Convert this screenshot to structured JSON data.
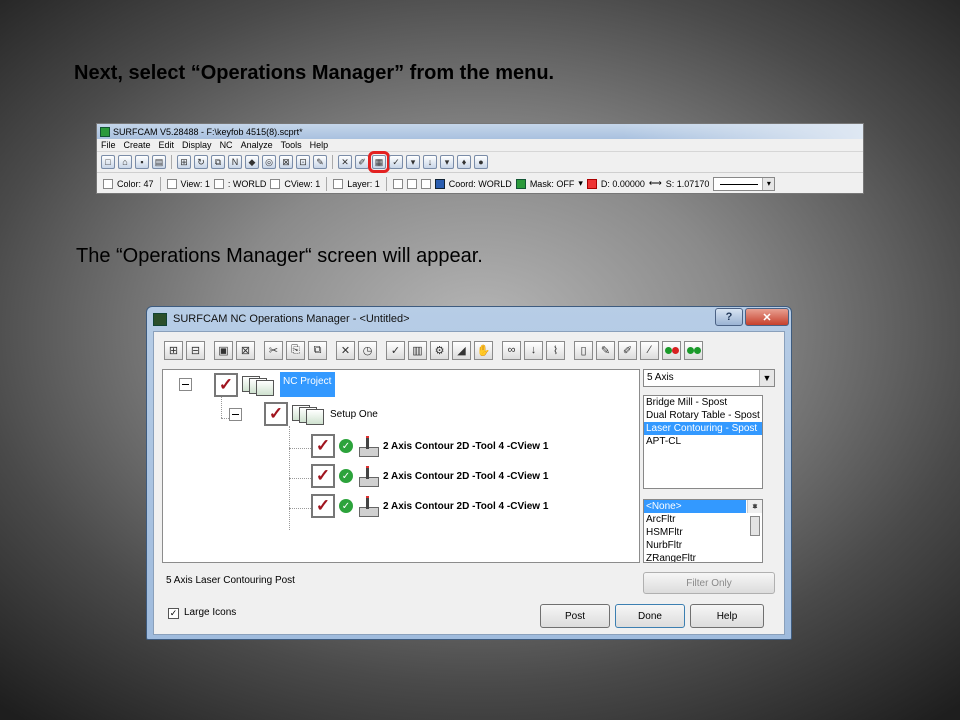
{
  "captions": {
    "step1": "Next, select  “Operations Manager” from the menu.",
    "step2": "The “Operations Manager“ screen will appear."
  },
  "surfcam": {
    "title": "SURFCAM V5.28488 - F:\\keyfob 4515(8).scprt*",
    "menu": [
      "File",
      "Create",
      "Edit",
      "Display",
      "NC",
      "Analyze",
      "Tools",
      "Help"
    ],
    "status": {
      "color": "Color: 47",
      "view": "View: 1",
      "world": ": WORLD",
      "cview": "CView: 1",
      "layer": "Layer: 1",
      "coord": "Coord: WORLD",
      "mask": "Mask: OFF",
      "d": "D: 0.00000",
      "s": "S: 1.07170"
    }
  },
  "ops_manager": {
    "title": "SURFCAM NC Operations Manager - <Untitled>",
    "tree": {
      "project": "NC Project",
      "setup": "Setup One",
      "operations": [
        "2 Axis Contour 2D  -Tool 4 -CView 1",
        "2 Axis Contour 2D  -Tool 4 -CView 1",
        "2 Axis Contour 2D  -Tool 4 -CView 1"
      ]
    },
    "axis_combo": "5 Axis",
    "posts": [
      "Bridge Mill - Spost",
      "Dual Rotary Table - Spost",
      "Laser Contouring - Spost",
      "APT-CL"
    ],
    "selected_post_index": 2,
    "filters": [
      "<None>",
      "ArcFltr",
      "HSMFltr",
      "NurbFltr",
      "ZRangeFltr"
    ],
    "filter_only_label": "Filter Only",
    "status_text": "5 Axis Laser Contouring Post",
    "large_icons_label": "Large Icons",
    "large_icons_checked": true,
    "buttons": {
      "post": "Post",
      "done": "Done",
      "help": "Help"
    },
    "caption_buttons": {
      "help": "?",
      "close": "✕"
    }
  }
}
